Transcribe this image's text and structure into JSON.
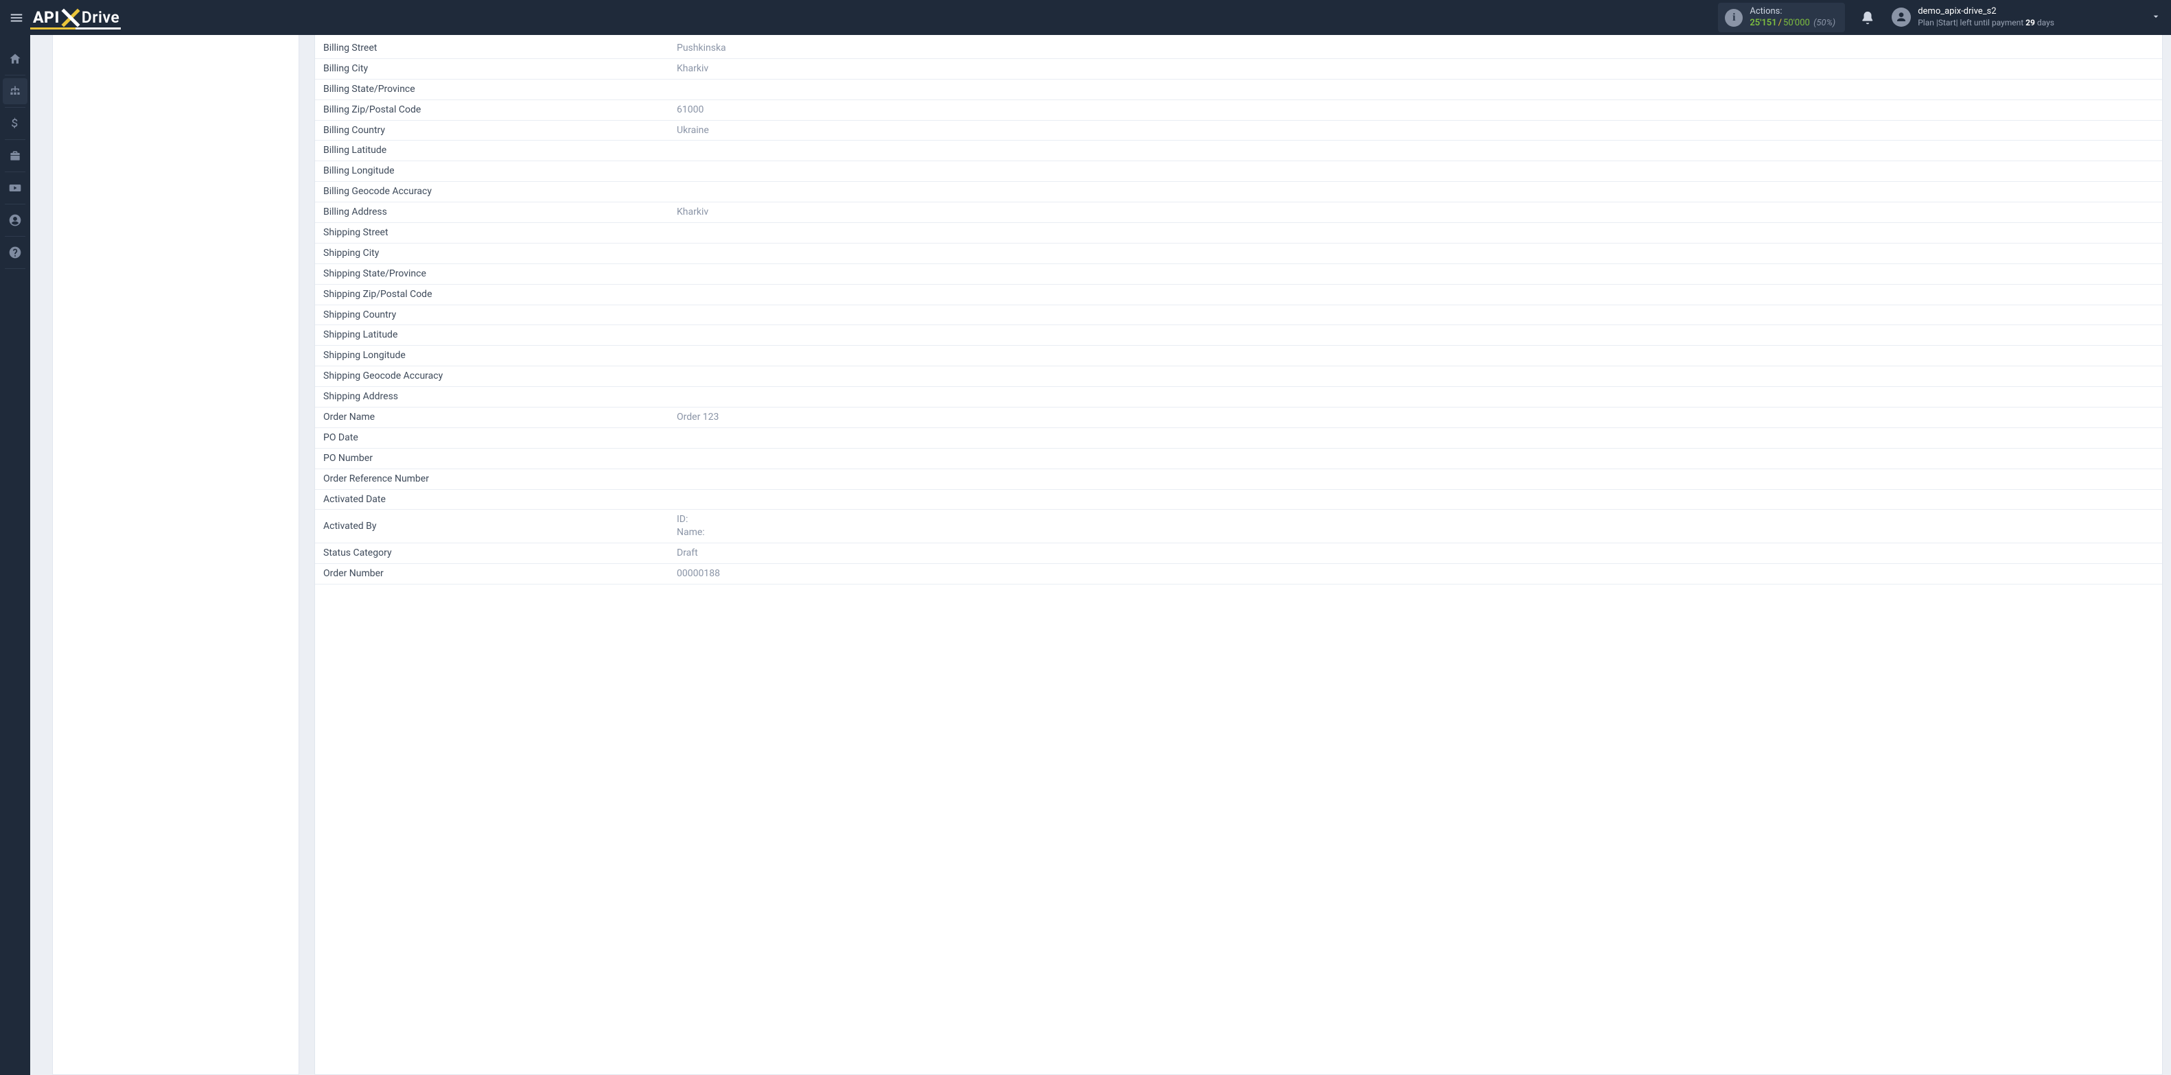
{
  "header": {
    "logo": {
      "api": "API",
      "drive": "Drive"
    },
    "actions": {
      "label": "Actions:",
      "used": "25'151",
      "total": "50'000",
      "pct": "(50%)"
    },
    "user": {
      "name": "demo_apix-drive_s2",
      "plan_prefix": "Plan |",
      "plan_name": "Start",
      "plan_mid": "| left until payment ",
      "days": "29",
      "days_suffix": " days"
    }
  },
  "sidebar": {
    "items": [
      {
        "name": "home-icon"
      },
      {
        "name": "sitemap-icon"
      },
      {
        "name": "dollar-icon"
      },
      {
        "name": "briefcase-icon"
      },
      {
        "name": "youtube-icon"
      },
      {
        "name": "user-icon"
      },
      {
        "name": "help-icon"
      }
    ]
  },
  "rows": [
    {
      "k": "Billing Street",
      "v": "Pushkinska"
    },
    {
      "k": "Billing City",
      "v": "Kharkiv"
    },
    {
      "k": "Billing State/Province",
      "v": ""
    },
    {
      "k": "Billing Zip/Postal Code",
      "v": "61000"
    },
    {
      "k": "Billing Country",
      "v": "Ukraine"
    },
    {
      "k": "Billing Latitude",
      "v": ""
    },
    {
      "k": "Billing Longitude",
      "v": ""
    },
    {
      "k": "Billing Geocode Accuracy",
      "v": ""
    },
    {
      "k": "Billing Address",
      "v": "Kharkiv"
    },
    {
      "k": "Shipping Street",
      "v": ""
    },
    {
      "k": "Shipping City",
      "v": ""
    },
    {
      "k": "Shipping State/Province",
      "v": ""
    },
    {
      "k": "Shipping Zip/Postal Code",
      "v": ""
    },
    {
      "k": "Shipping Country",
      "v": ""
    },
    {
      "k": "Shipping Latitude",
      "v": ""
    },
    {
      "k": "Shipping Longitude",
      "v": ""
    },
    {
      "k": "Shipping Geocode Accuracy",
      "v": ""
    },
    {
      "k": "Shipping Address",
      "v": ""
    },
    {
      "k": "Order Name",
      "v": "Order 123"
    },
    {
      "k": "PO Date",
      "v": ""
    },
    {
      "k": "PO Number",
      "v": ""
    },
    {
      "k": "Order Reference Number",
      "v": ""
    },
    {
      "k": "Activated Date",
      "v": ""
    },
    {
      "k": "Activated By",
      "v": "ID:\nName:"
    },
    {
      "k": "Status Category",
      "v": "Draft"
    },
    {
      "k": "Order Number",
      "v": "00000188"
    }
  ]
}
